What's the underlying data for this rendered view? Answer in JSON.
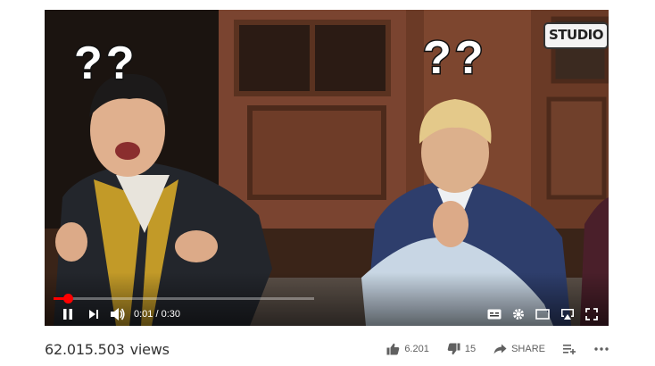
{
  "video": {
    "watermark": "STUDIO",
    "overlay_left": "??",
    "overlay_right": "??",
    "time_current": "0:01",
    "time_separator": "/",
    "time_total": "0:30",
    "progress_fraction": 0.055
  },
  "stats": {
    "views_count": "62.015.503",
    "views_label": "views",
    "likes": "6.201",
    "dislikes": "15",
    "share_label": "SHARE"
  },
  "icons": {
    "play_state": "pause-icon",
    "next": "next-icon",
    "volume": "volume-icon",
    "captions": "captions-icon",
    "settings": "gear-icon",
    "miniplayer": "miniplayer-icon",
    "airplay": "airplay-icon",
    "fullscreen": "fullscreen-icon",
    "like": "thumbs-up-icon",
    "dislike": "thumbs-down-icon",
    "share": "share-icon",
    "save": "add-to-playlist-icon",
    "more": "more-icon"
  },
  "colors": {
    "progress": "#ff0000",
    "controls": "#ffffff",
    "text_muted": "#606060"
  }
}
